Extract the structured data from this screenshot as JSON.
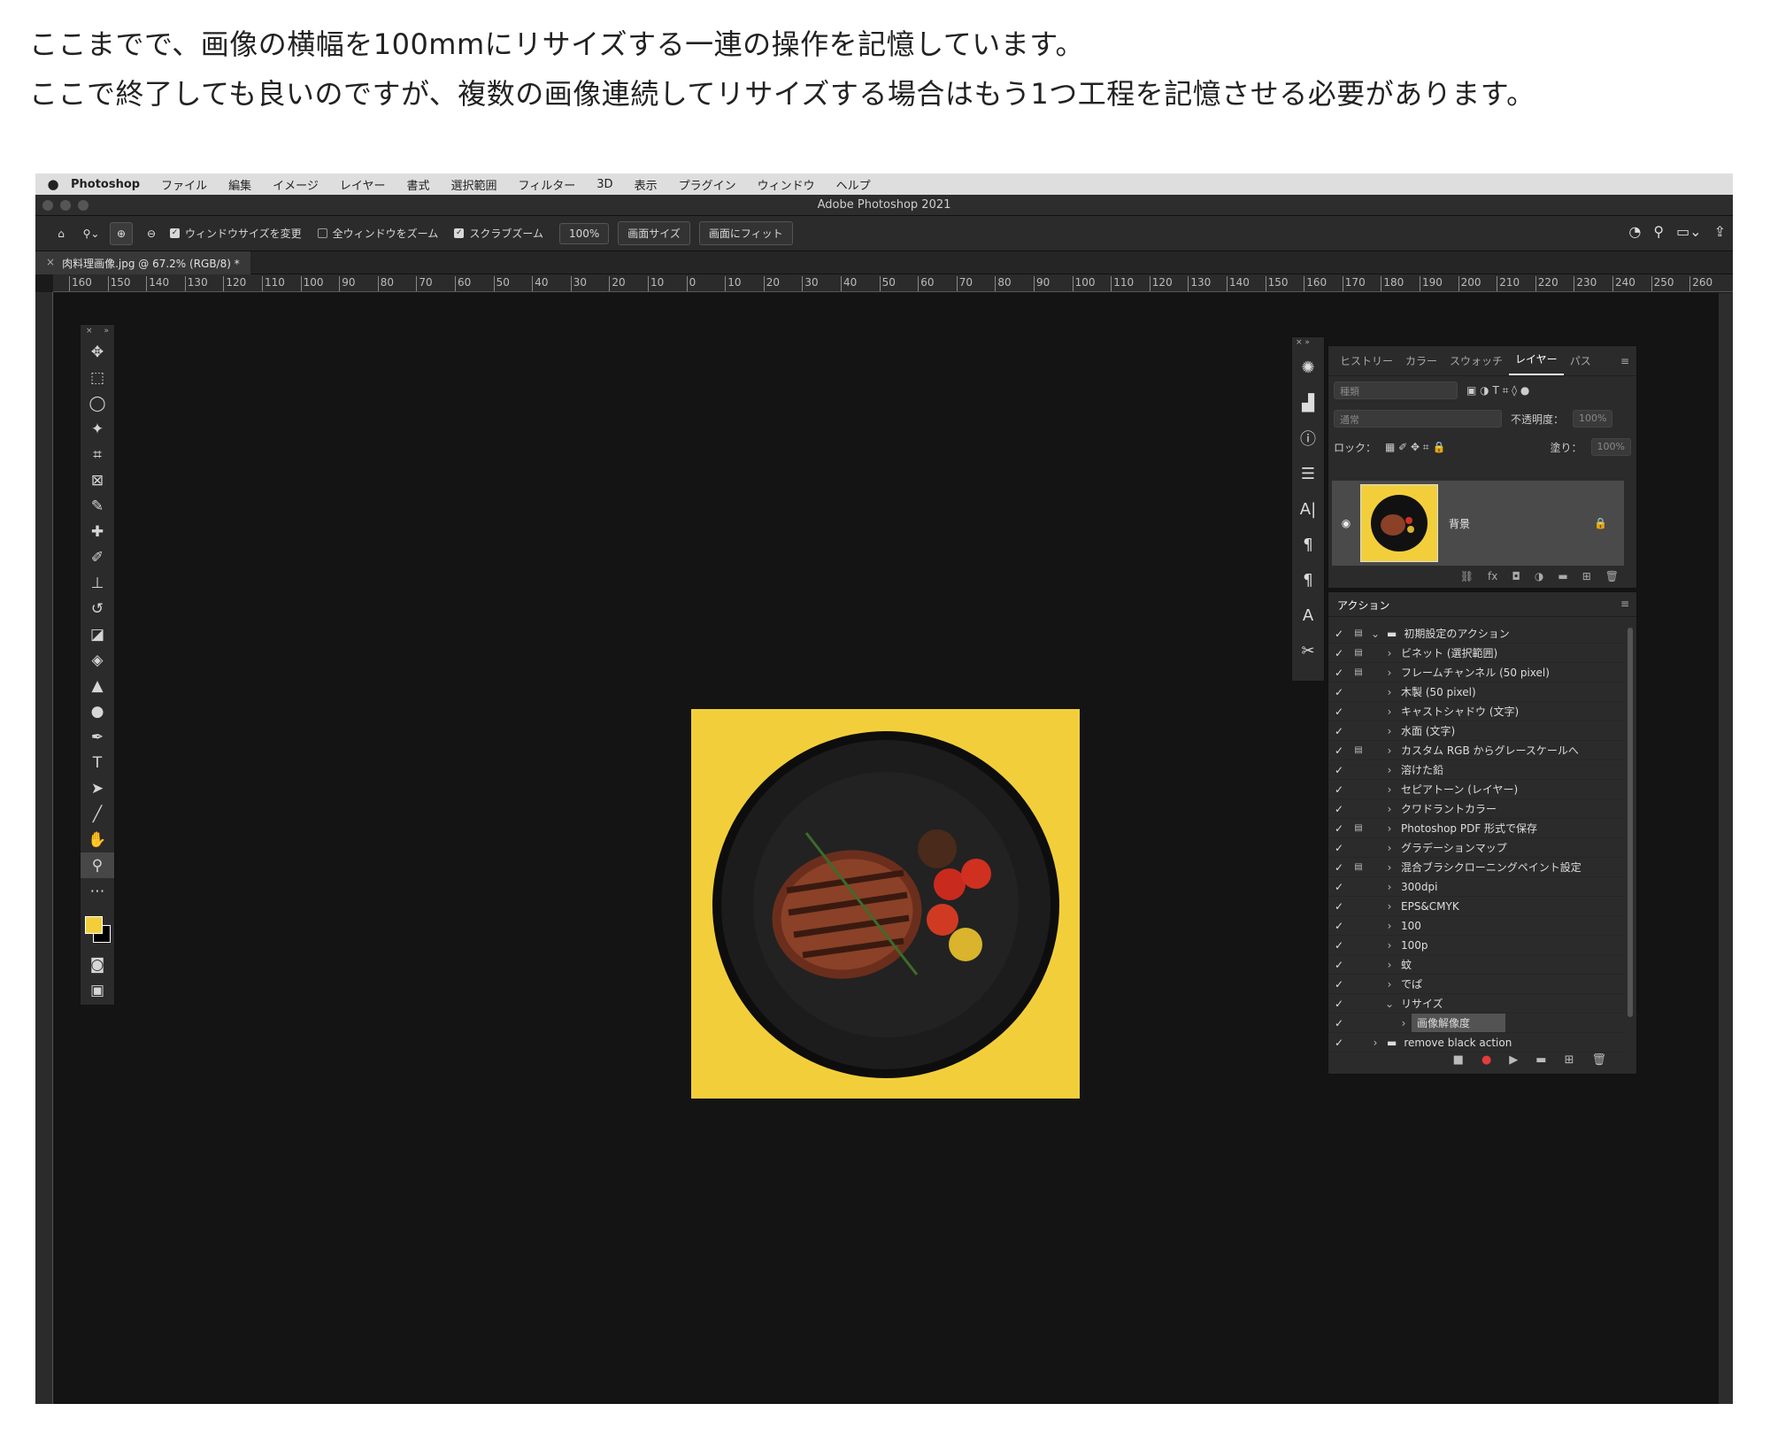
{
  "intro": {
    "line1": "ここまでで、画像の横幅を100mmにリサイズする一連の操作を記憶しています。",
    "line2": "ここで終了しても良いのですが、複数の画像連続してリサイズする場合はもう1つ工程を記憶させる必要があります。"
  },
  "menubar": {
    "apple": "",
    "app": "Photoshop",
    "items": [
      "ファイル",
      "編集",
      "イメージ",
      "レイヤー",
      "書式",
      "選択範囲",
      "フィルター",
      "3D",
      "表示",
      "プラグイン",
      "ウィンドウ",
      "ヘルプ"
    ]
  },
  "window_title": "Adobe Photoshop 2021",
  "options_bar": {
    "resize_windows": "ウィンドウサイズを変更",
    "zoom_all": "全ウィンドウをズーム",
    "scrubby_zoom": "スクラブズーム",
    "zoom_value": "100%",
    "fit_screen": "画面サイズ",
    "fill_screen": "画面にフィット"
  },
  "document_tab": {
    "close": "×",
    "title": "肉料理画像.jpg @ 67.2% (RGB/8) *"
  },
  "ruler_ticks": [
    "160",
    "150",
    "140",
    "130",
    "120",
    "110",
    "100",
    "90",
    "80",
    "70",
    "60",
    "50",
    "40",
    "30",
    "20",
    "10",
    "0",
    "10",
    "20",
    "30",
    "40",
    "50",
    "60",
    "70",
    "80",
    "90",
    "100",
    "110",
    "120",
    "130",
    "140",
    "150",
    "160",
    "170",
    "180",
    "190",
    "200",
    "210",
    "220",
    "230",
    "240",
    "250",
    "260"
  ],
  "colors": {
    "foreground": "#f2cf3a",
    "background": "#000000",
    "image_bg": "#f2cf3a",
    "record": "#e23c3c"
  },
  "layers_panel": {
    "tabs": [
      "ヒストリー",
      "カラー",
      "スウォッチ",
      "レイヤー",
      "パス"
    ],
    "active_tab": "レイヤー",
    "filter_placeholder": "種類",
    "blend_mode": "通常",
    "opacity_label": "不透明度：",
    "opacity_value": "100%",
    "lock_label": "ロック：",
    "fill_label": "塗り：",
    "fill_value": "100%",
    "layer_name": "背景"
  },
  "actions_panel": {
    "title": "アクション",
    "items": [
      {
        "name": "初期設定のアクション",
        "dialog": true,
        "expand": "⌄",
        "folder": true,
        "indent": 0
      },
      {
        "name": "ビネット (選択範囲)",
        "dialog": true,
        "expand": "›",
        "folder": false,
        "indent": 1
      },
      {
        "name": "フレームチャンネル (50 pixel)",
        "dialog": true,
        "expand": "›",
        "folder": false,
        "indent": 1
      },
      {
        "name": "木製 (50 pixel)",
        "dialog": false,
        "expand": "›",
        "folder": false,
        "indent": 1
      },
      {
        "name": "キャストシャドウ (文字)",
        "dialog": false,
        "expand": "›",
        "folder": false,
        "indent": 1
      },
      {
        "name": "水面 (文字)",
        "dialog": false,
        "expand": "›",
        "folder": false,
        "indent": 1
      },
      {
        "name": "カスタム RGB からグレースケールへ",
        "dialog": true,
        "expand": "›",
        "folder": false,
        "indent": 1
      },
      {
        "name": "溶けた鉛",
        "dialog": false,
        "expand": "›",
        "folder": false,
        "indent": 1
      },
      {
        "name": "セピアトーン (レイヤー)",
        "dialog": false,
        "expand": "›",
        "folder": false,
        "indent": 1
      },
      {
        "name": "クワドラントカラー",
        "dialog": false,
        "expand": "›",
        "folder": false,
        "indent": 1
      },
      {
        "name": "Photoshop PDF 形式で保存",
        "dialog": true,
        "expand": "›",
        "folder": false,
        "indent": 1
      },
      {
        "name": "グラデーションマップ",
        "dialog": false,
        "expand": "›",
        "folder": false,
        "indent": 1
      },
      {
        "name": "混合ブラシクローニングペイント設定",
        "dialog": true,
        "expand": "›",
        "folder": false,
        "indent": 1
      },
      {
        "name": "300dpi",
        "dialog": false,
        "expand": "›",
        "folder": false,
        "indent": 1
      },
      {
        "name": "EPS&CMYK",
        "dialog": false,
        "expand": "›",
        "folder": false,
        "indent": 1
      },
      {
        "name": "100",
        "dialog": false,
        "expand": "›",
        "folder": false,
        "indent": 1
      },
      {
        "name": "100p",
        "dialog": false,
        "expand": "›",
        "folder": false,
        "indent": 1
      },
      {
        "name": "蚊",
        "dialog": false,
        "expand": "›",
        "folder": false,
        "indent": 1
      },
      {
        "name": "でぱ",
        "dialog": false,
        "expand": "›",
        "folder": false,
        "indent": 1
      },
      {
        "name": "リサイズ",
        "dialog": false,
        "expand": "⌄",
        "folder": false,
        "indent": 1
      },
      {
        "name": "画像解像度",
        "dialog": false,
        "expand": "›",
        "folder": false,
        "indent": 2,
        "selected": true
      },
      {
        "name": "remove black action",
        "dialog": false,
        "expand": "›",
        "folder": true,
        "indent": 0
      }
    ]
  }
}
